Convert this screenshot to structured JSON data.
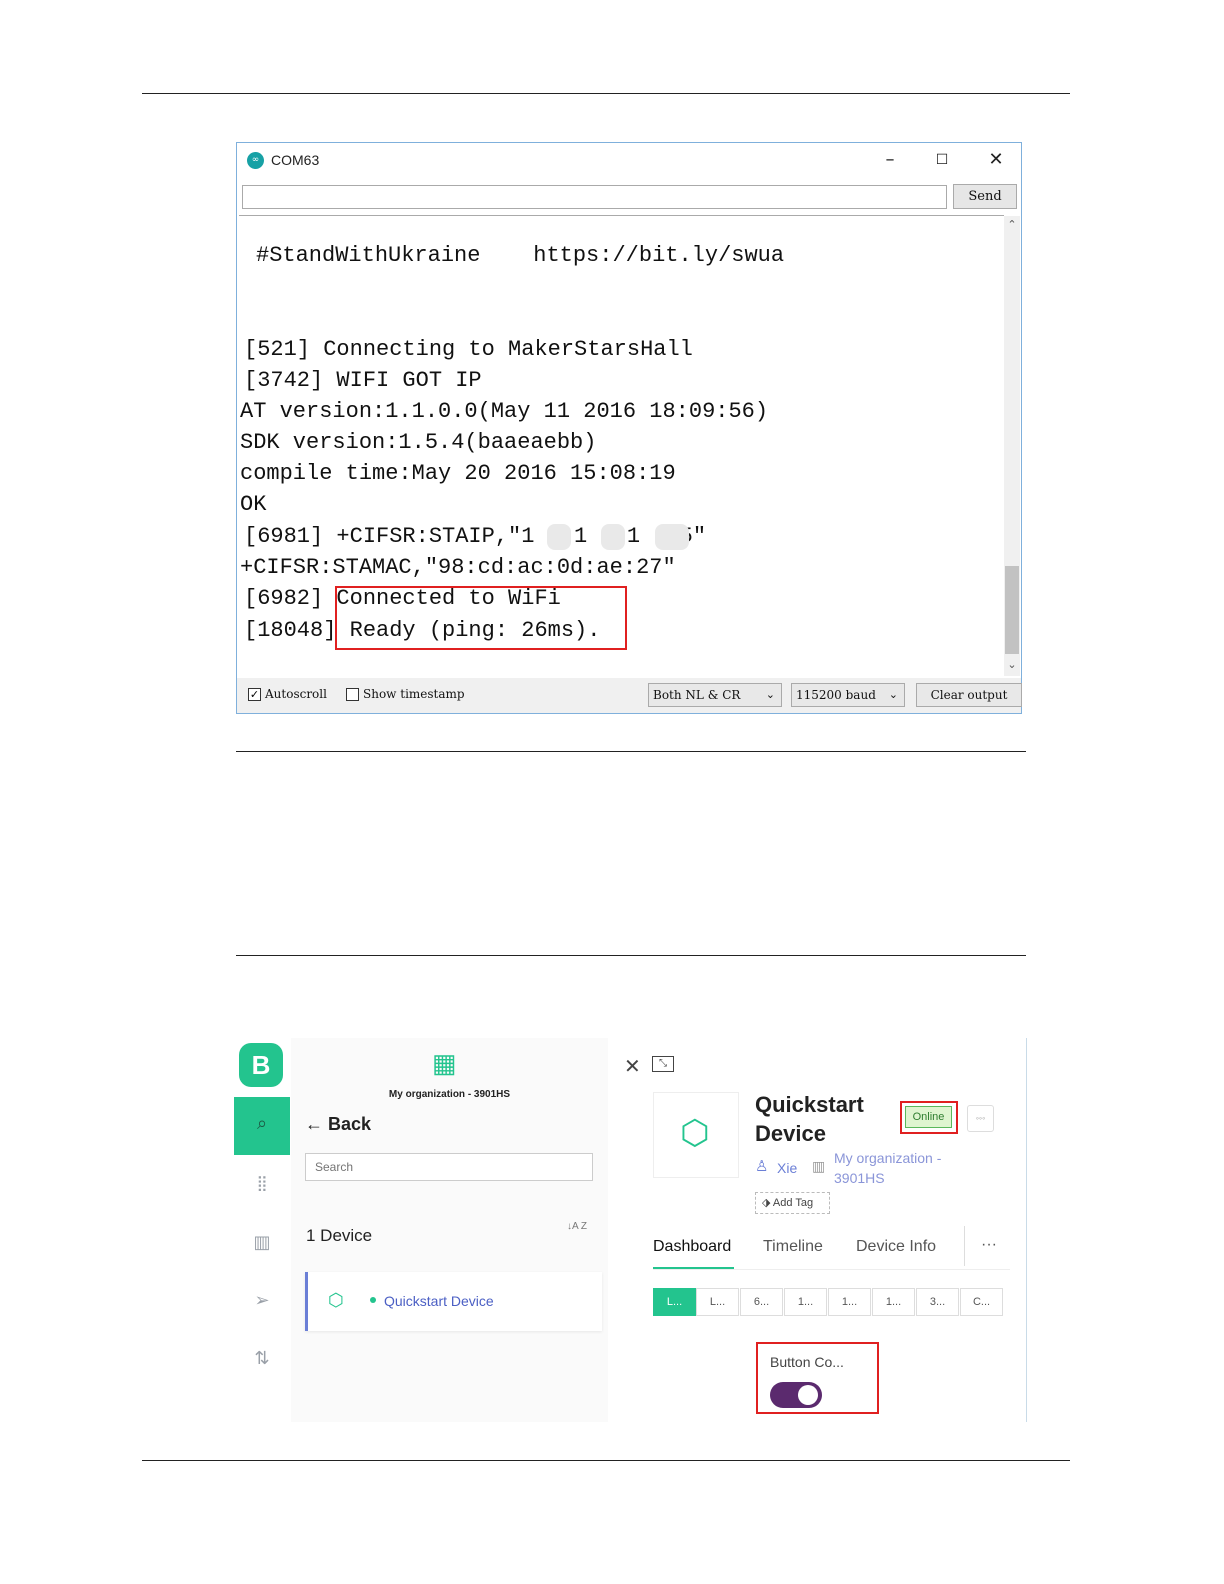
{
  "serial_monitor": {
    "window_title": "COM63",
    "send_label": "Send",
    "input_value": "",
    "lines": [
      "#StandWithUkraine    https://bit.ly/swua",
      "[521] Connecting to MakerStarsHall",
      "[3742] WIFI GOT IP",
      "AT version:1.1.0.0(May 11 2016 18:09:56)",
      "SDK version:1.5.4(baaeaebb)",
      "compile time:May 20 2016 15:08:19",
      "OK",
      "[6981] +CIFSR:STAIP,\"1  .1  .1  75\"",
      "+CIFSR:STAMAC,\"98:cd:ac:0d:ae:27\"",
      "[6982] Connected to WiFi",
      "[18048] Ready (ping: 26ms)."
    ],
    "autoscroll_label": "Autoscroll",
    "autoscroll_checked": true,
    "timestamp_label": "Show timestamp",
    "timestamp_checked": false,
    "line_ending": "Both NL & CR",
    "baud": "115200 baud",
    "clear_label": "Clear output",
    "highlight_color": "#e02020"
  },
  "blynk": {
    "logo_letter": "B",
    "accent_color": "#23c48e",
    "org_label": "My organization - 3901HS",
    "back_label": "Back",
    "search_placeholder": "Search",
    "device_count": "1 Device",
    "sort_label": "A Z",
    "device_name": "Quickstart Device",
    "detail": {
      "title_line1": "Quickstart",
      "title_line2": "Device",
      "status": "Online",
      "owner": "Xie",
      "org_line1": "My organization -",
      "org_line2": "3901HS",
      "add_tag": "Add Tag",
      "tabs": [
        "Dashboard",
        "Timeline",
        "Device Info"
      ],
      "more": "···",
      "segments": [
        "L...",
        "L...",
        "6...",
        "1...",
        "1...",
        "1...",
        "3...",
        "C..."
      ],
      "widget_title": "Button Co...",
      "switch_on": true,
      "switch_color": "#5b2a6e"
    }
  }
}
